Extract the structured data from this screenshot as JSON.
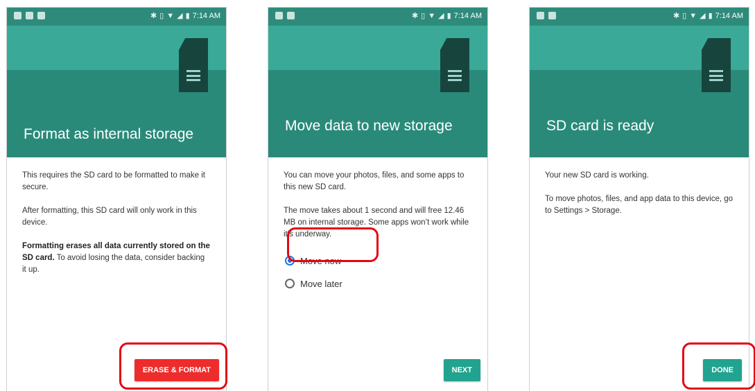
{
  "status_bar": {
    "time": "7:14 AM"
  },
  "colors": {
    "teal": "#2e8b7b",
    "highlight": "#e30613",
    "erase_button": "#ee2c2c",
    "teal_button": "#21a390",
    "radio_accent": "#1a73e8"
  },
  "screens": [
    {
      "title": "Format as internal storage",
      "paragraphs": [
        "This requires the SD card to be formatted to make it secure.",
        "After formatting, this SD card will only work in this device."
      ],
      "warning_bold": "Formatting erases all data currently stored on the SD card.",
      "warning_rest": " To avoid losing the data, consider backing it up.",
      "button": "ERASE & FORMAT"
    },
    {
      "title": "Move data to new storage",
      "paragraphs": [
        "You can move your photos, files, and some apps to this new SD card.",
        "The move takes about 1 second and will free 12.46 MB on internal storage. Some apps won’t work while it’s underway."
      ],
      "options": [
        {
          "label": "Move now",
          "selected": true
        },
        {
          "label": "Move later",
          "selected": false
        }
      ],
      "button": "NEXT"
    },
    {
      "title": "SD card is ready",
      "paragraphs": [
        "Your new SD card is working.",
        "To move photos, files, and app data to this device, go to Settings > Storage."
      ],
      "button": "DONE"
    }
  ],
  "icons": [
    "sd-card-icon",
    "radio-checked-icon",
    "radio-unchecked-icon"
  ]
}
